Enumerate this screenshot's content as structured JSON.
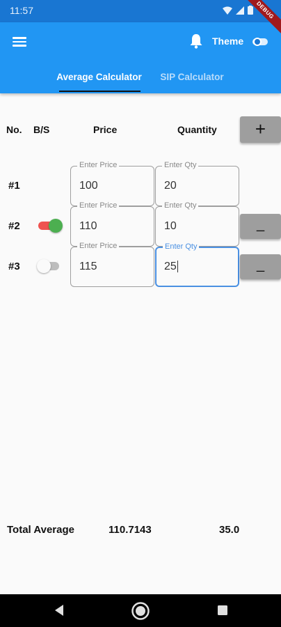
{
  "status_bar": {
    "time": "11:57",
    "debug_banner": "DEBUG"
  },
  "app_bar": {
    "theme_label": "Theme",
    "theme_switch_on": false,
    "tabs": [
      {
        "label": "Average Calculator",
        "active": true
      },
      {
        "label": "SIP Calculator",
        "active": false
      }
    ]
  },
  "table": {
    "headers": {
      "no": "No.",
      "bs": "B/S",
      "price": "Price",
      "quantity": "Quantity"
    },
    "add_button": "+",
    "remove_button": "_",
    "price_placeholder": "Enter Price",
    "qty_placeholder": "Enter Qty",
    "rows": [
      {
        "label": "#1",
        "price": "100",
        "qty": "20",
        "has_toggle": false,
        "removable": false
      },
      {
        "label": "#2",
        "price": "110",
        "qty": "10",
        "has_toggle": true,
        "toggle_on": true,
        "removable": true
      },
      {
        "label": "#3",
        "price": "115",
        "qty": "25",
        "has_toggle": true,
        "toggle_on": false,
        "removable": true,
        "qty_focused": true
      }
    ]
  },
  "totals": {
    "label": "Total Average",
    "average": "110.7143",
    "quantity": "35.0"
  },
  "colors": {
    "status_bar": "#1976D2",
    "app_bar": "#2196F3",
    "toggle_on_track": "#ef5350",
    "toggle_on_thumb": "#4CAF50",
    "toggle_off_track": "#bdbdbd",
    "toggle_off_thumb": "#fafafa",
    "focus": "#4a90e2",
    "button": "#9e9e9e"
  }
}
